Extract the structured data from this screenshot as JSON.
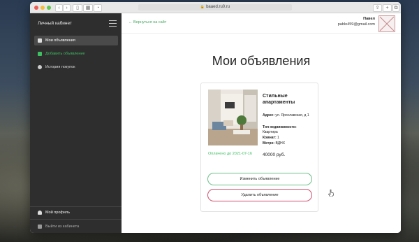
{
  "browser": {
    "url": "baaed.ru0.ru"
  },
  "sidebar": {
    "title": "Личный кабинет",
    "items": [
      {
        "label": "Мои объявления"
      },
      {
        "label": "Добавить объявление"
      },
      {
        "label": "История покупок"
      }
    ],
    "profile_label": "Мой профиль",
    "logout_label": "Выйти из кабинета"
  },
  "header": {
    "back_label": "Вернуться на сайт",
    "user_name": "Павел",
    "user_email": "pablo459@gmail.com"
  },
  "main": {
    "title": "Мои объявления"
  },
  "listing": {
    "title": "Стильные апартаменты",
    "address_label": "Адрес:",
    "address_value": "ул. Ярославская, д 1",
    "type_label": "Тип недвижимости:",
    "type_value": "Квартира",
    "rooms_label": "Комнат:",
    "rooms_value": "1",
    "metro_label": "Метро:",
    "metro_value": "ВДНХ",
    "paid_until": "Оплачено до 2021-07-16",
    "price": "40000 руб.",
    "edit_label": "Изменить объявление",
    "delete_label": "Удалить объявление"
  },
  "colors": {
    "sidebar_bg": "#2e2e2e",
    "accent_green": "#3fbf63",
    "danger": "#d0506b"
  }
}
